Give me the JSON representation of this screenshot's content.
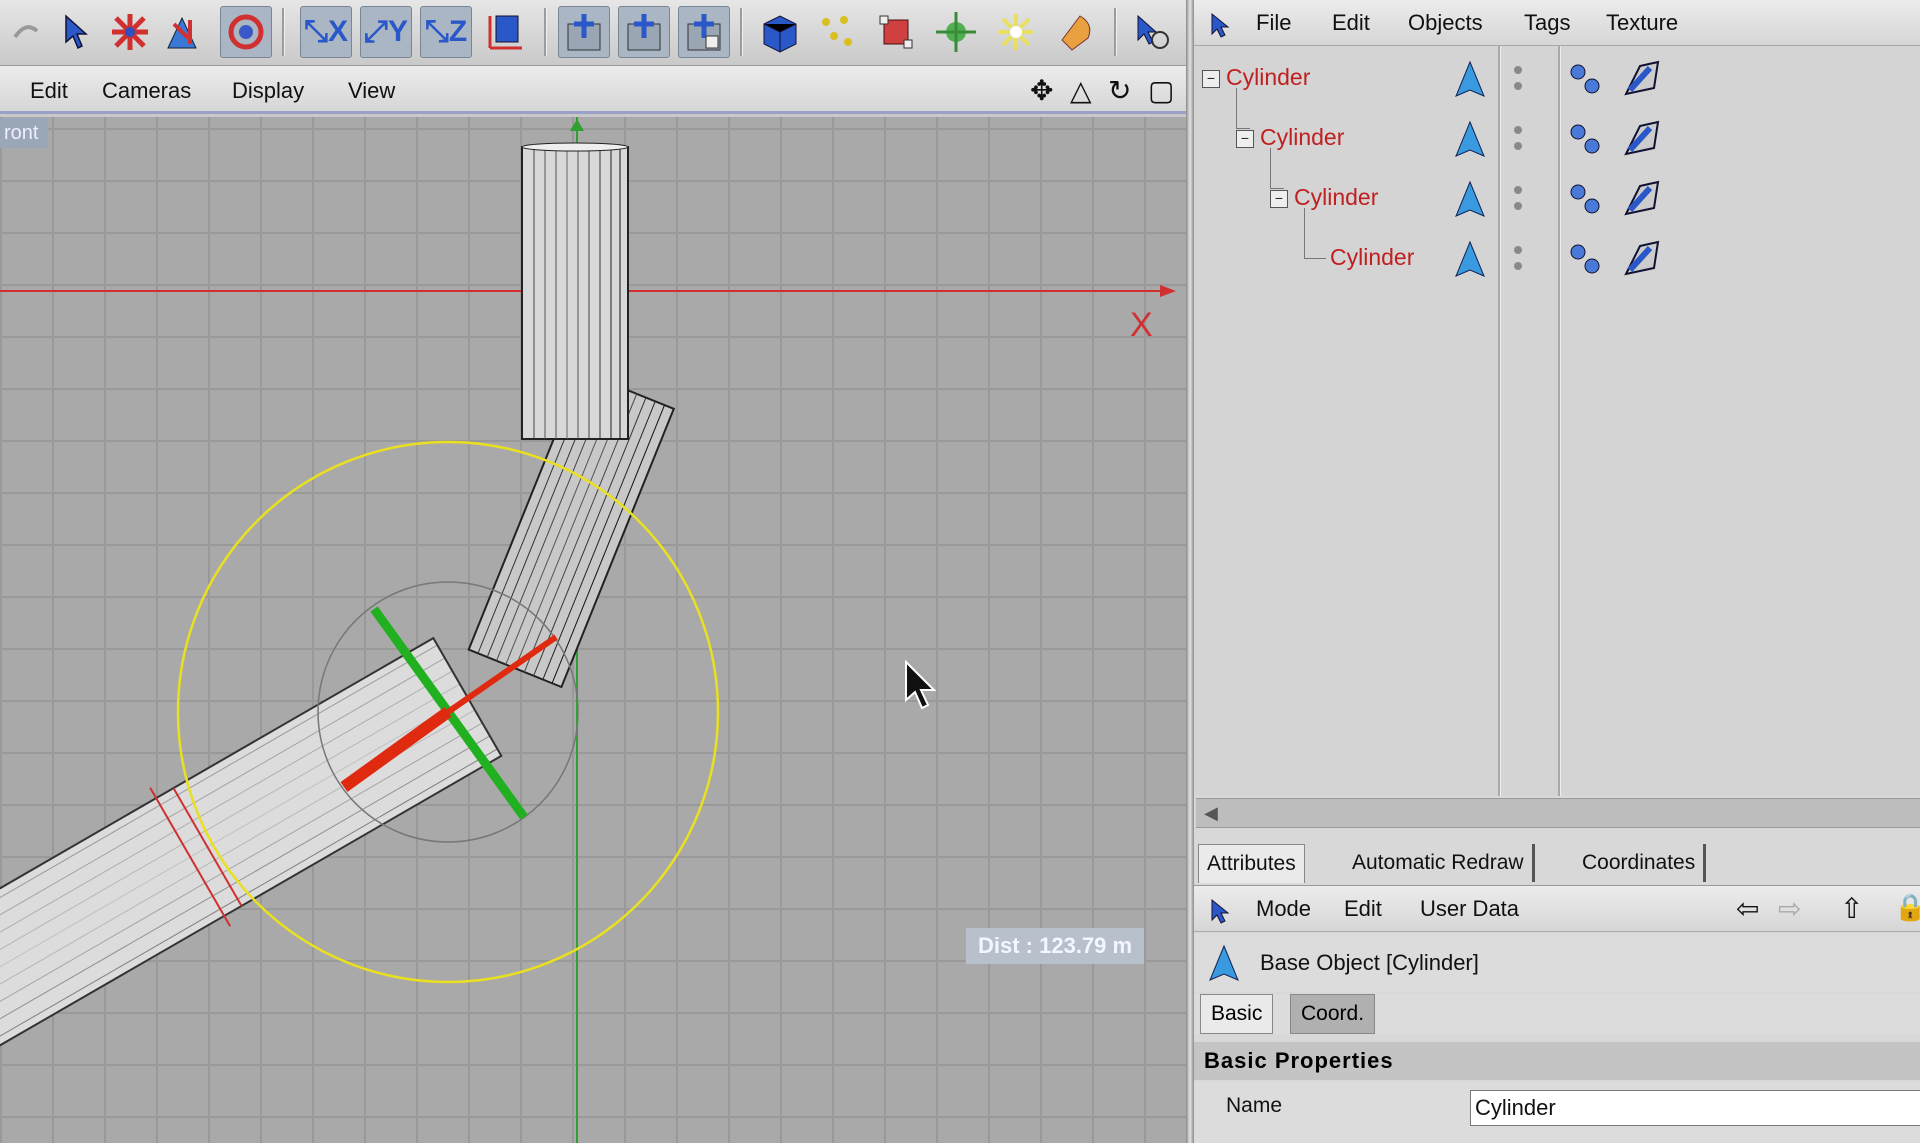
{
  "viewport_menu": {
    "items": [
      "Edit",
      "Cameras",
      "Display",
      "View"
    ]
  },
  "viewport": {
    "view_label": "ront",
    "distance_readout": "Dist : 123.79 m",
    "axis_label": "X"
  },
  "object_manager": {
    "menu": [
      "File",
      "Edit",
      "Objects",
      "Tags",
      "Texture"
    ],
    "objects": [
      "Cylinder",
      "Cylinder",
      "Cylinder",
      "Cylinder"
    ]
  },
  "attributes": {
    "tabs": [
      "Attributes",
      "Automatic Redraw",
      "Coordinates"
    ],
    "menu": [
      "Mode",
      "Edit",
      "User Data"
    ],
    "object_title": "Base Object [Cylinder]",
    "subtabs": [
      "Basic",
      "Coord."
    ],
    "section": "Basic Properties",
    "name_label": "Name",
    "name_value": "Cylinder"
  },
  "colors": {
    "object_name": "#c02020",
    "x_axis": "#d03030",
    "y_axis": "#20a020",
    "selection_ring": "#e8e000"
  },
  "icons": [
    "select-arrow",
    "move",
    "scale",
    "rotate",
    "x-axis-lock",
    "y-axis-lock",
    "z-axis-lock",
    "world-coords",
    "render-view",
    "render-region",
    "render-manager",
    "cube-primitive",
    "null-object",
    "spline",
    "deformer",
    "light",
    "material",
    "live-select"
  ]
}
